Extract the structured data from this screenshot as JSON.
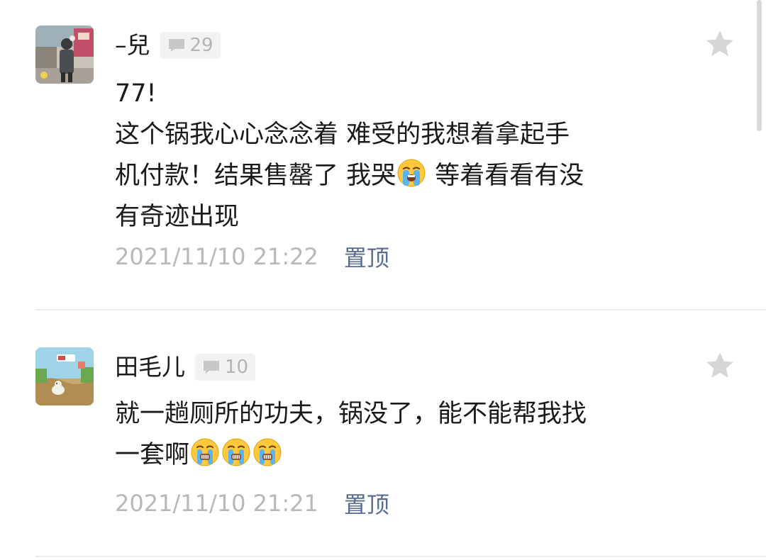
{
  "comments": [
    {
      "nickname": "–兒",
      "reply_count": "29",
      "content_line_1": "77!",
      "content_line_2": "这个锅我心心念念着 难受的我想着拿起手",
      "content_line_3a": "机付款！结果售罄了 我哭",
      "content_line_3b": " 等着看看有没",
      "content_line_4": "有奇迹出现",
      "timestamp": "2021/11/10 21:22",
      "pin_label": "置顶",
      "emoji_icon": "loudly-crying-face",
      "avatar_desc": "photo"
    },
    {
      "nickname": "田毛儿",
      "reply_count": "10",
      "content_line_1": "就一趟厕所的功夫，锅没了，能不能帮我找",
      "content_line_2": "一套啊",
      "timestamp": "2021/11/10 21:21",
      "pin_label": "置顶",
      "emoji_icon": "crying-face",
      "avatar_desc": "game-screenshot"
    }
  ],
  "colors": {
    "link": "#576b95",
    "timestamp": "#b8b8b8",
    "badge_bg": "#f2f2f2",
    "star": "#d6d6d6",
    "divider": "#ececec"
  }
}
